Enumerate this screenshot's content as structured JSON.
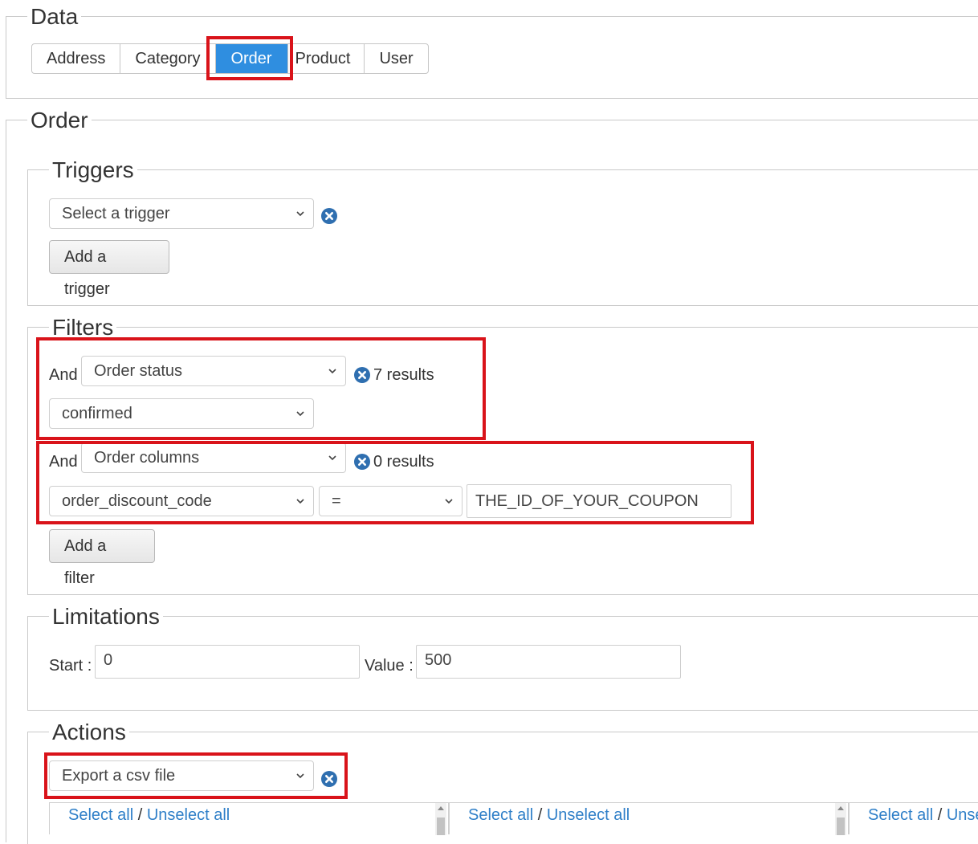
{
  "data_section": {
    "legend": "Data",
    "tabs": [
      "Address",
      "Category",
      "Order",
      "Product",
      "User"
    ],
    "active_tab": "Order"
  },
  "order_section": {
    "legend": "Order",
    "triggers": {
      "legend": "Triggers",
      "select_value": "Select a trigger",
      "add_button": "Add a trigger"
    },
    "filters": {
      "legend": "Filters",
      "rows": [
        {
          "conj": "And",
          "type": "Order status",
          "results": "7 results",
          "value": "confirmed"
        },
        {
          "conj": "And",
          "type": "Order columns",
          "results": "0 results",
          "column": "order_discount_code",
          "operator": "=",
          "input": "THE_ID_OF_YOUR_COUPON"
        }
      ],
      "add_button": "Add a filter"
    },
    "limitations": {
      "legend": "Limitations",
      "start_label": "Start :",
      "start_value": "0",
      "value_label": "Value :",
      "value_value": "500"
    },
    "actions": {
      "legend": "Actions",
      "select_value": "Export a csv file",
      "columns": [
        {
          "select_all": "Select all",
          "sep": "/",
          "unselect_all": "Unselect all"
        },
        {
          "select_all": "Select all",
          "sep": "/",
          "unselect_all": "Unselect all"
        },
        {
          "select_all": "Select all",
          "sep": "/",
          "unselect_all": "Unse"
        }
      ]
    }
  },
  "colors": {
    "accent": "#2f8ee0",
    "highlight": "#d9131a",
    "icon": "#2f6fb0",
    "link": "#2f7fc8"
  },
  "icons": {
    "remove": "remove-circle-icon",
    "dropdown": "chevron-down-icon"
  }
}
